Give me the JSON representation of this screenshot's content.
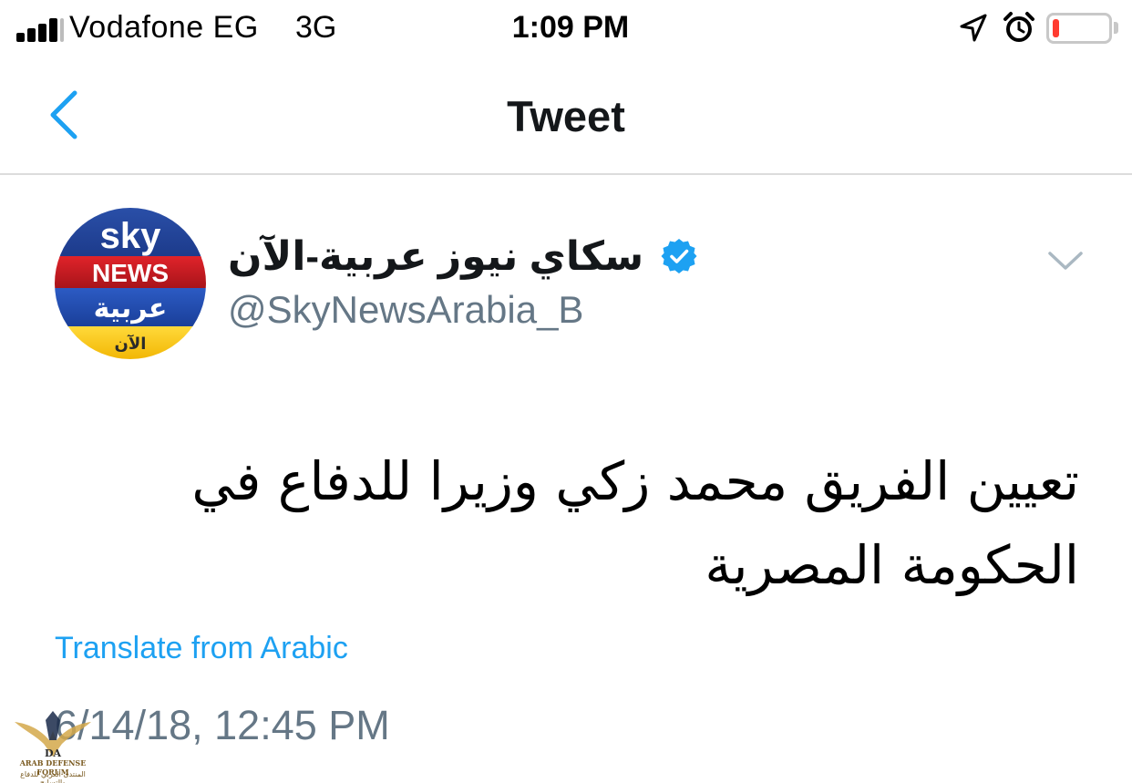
{
  "status_bar": {
    "carrier": "Vodafone EG",
    "network": "3G",
    "time": "1:09 PM",
    "icons": [
      "signal-icon",
      "location-arrow-icon",
      "alarm-clock-icon",
      "battery-icon"
    ],
    "battery_level": 0.12,
    "battery_color": "#ff3b30"
  },
  "nav": {
    "title": "Tweet",
    "back_icon": "chevron-left-icon",
    "accent_color": "#1da1f2"
  },
  "tweet": {
    "author": {
      "display_name": "سكاي نيوز عربية-الآن",
      "handle": "@SkyNewsArabia_B",
      "verified": true,
      "avatar": {
        "line1": "sky",
        "line2": "NEWS",
        "line3": "عربية",
        "line4": "الآن"
      }
    },
    "text": "تعيين الفريق محمد زكي وزيرا للدفاع في الحكومة المصرية",
    "translate_label": "Translate from Arabic",
    "timestamp": "6/14/18, 12:45 PM"
  },
  "watermark": {
    "line1": "ARAB DEFENSE FORUM",
    "line2": "المنتدى العربي للدفاع والتسليح",
    "logo": "DA"
  }
}
